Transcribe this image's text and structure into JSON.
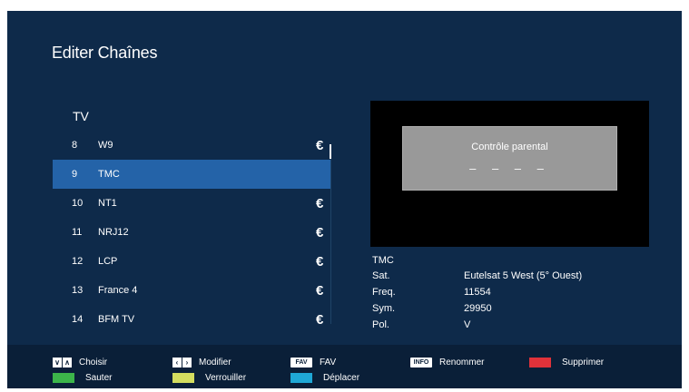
{
  "title": "Editer Chaînes",
  "list": {
    "header": "TV",
    "channels": [
      {
        "num": "8",
        "name": "W9",
        "euro": "€"
      },
      {
        "num": "9",
        "name": "TMC",
        "euro": ""
      },
      {
        "num": "10",
        "name": "NT1",
        "euro": "€"
      },
      {
        "num": "11",
        "name": "NRJ12",
        "euro": "€"
      },
      {
        "num": "12",
        "name": "LCP",
        "euro": "€"
      },
      {
        "num": "13",
        "name": "France 4",
        "euro": "€"
      },
      {
        "num": "14",
        "name": "BFM TV",
        "euro": "€"
      }
    ],
    "selected_index": 1
  },
  "preview": {
    "parental_label": "Contrôle parental",
    "pin_placeholder": "– – – –"
  },
  "info": {
    "channel_name": "TMC",
    "rows": [
      {
        "key": "Sat.",
        "value": "Eutelsat 5 West (5° Ouest)"
      },
      {
        "key": "Freq.",
        "value": "11554"
      },
      {
        "key": "Sym.",
        "value": "29950"
      },
      {
        "key": "Pol.",
        "value": "V"
      }
    ]
  },
  "footer": {
    "choose_label": "Choisir",
    "modify_label": "Modifier",
    "fav_key": "FAV",
    "fav_label": "FAV",
    "info_key": "INFO",
    "rename_label": "Renommer",
    "delete_label": "Supprimer",
    "skip_label": "Sauter",
    "lock_label": "Verrouiller",
    "move_label": "Déplacer",
    "colors": {
      "red": "#e0323a",
      "green": "#3cb54a",
      "yellow": "#d4dd5f",
      "blue": "#1fa8d6"
    },
    "icons": {
      "choose": [
        "chevron-down-icon",
        "chevron-up-icon"
      ],
      "modify": [
        "chevron-left-icon",
        "chevron-right-icon"
      ]
    }
  }
}
